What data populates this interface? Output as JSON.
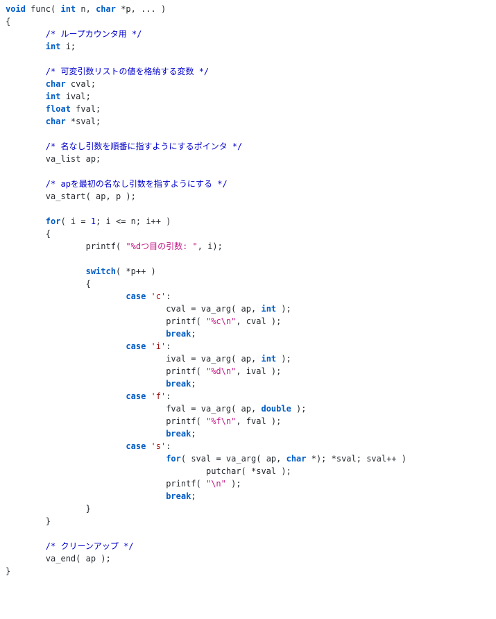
{
  "code": {
    "sig_void": "void",
    "sig_func": " func( ",
    "sig_int": "int",
    "sig_n": " n, ",
    "sig_char": "char",
    "sig_p": " *p, ... )",
    "lbrace": "{",
    "c1": "/* ループカウンタ用 */",
    "d1_kw": "int",
    "d1": " i;",
    "c2": "/* 可変引数リストの値を格納する変数 */",
    "d2_kw": "char",
    "d2": " cval;",
    "d3_kw": "int",
    "d3": " ival;",
    "d4_kw": "float",
    "d4": " fval;",
    "d5_kw": "char",
    "d5": " *sval;",
    "c3": "/* 名なし引数を順番に指すようにするポインタ */",
    "d6": "va_list ap;",
    "c4": "/* apを最初の名なし引数を指すようにする */",
    "d7": "va_start( ap, p );",
    "for_kw": "for",
    "for_open": "( i = ",
    "for_one": "1",
    "for_rest": "; i <= n; i++ )",
    "for_lbrace": "{",
    "pr_head": "printf( ",
    "pr_fmt": "\"%dつ目の引数: \"",
    "pr_tail": ", i);",
    "switch_kw": "switch",
    "switch_arg": "( *p++ )",
    "switch_lbrace": "{",
    "case_kw": "case",
    "case_c_lit": "'c'",
    "case_c_colon": ":",
    "case_c_l1a": "cval = va_arg( ap, ",
    "case_c_l1kw": "int",
    "case_c_l1b": " );",
    "case_c_l2a": "printf( ",
    "case_c_l2s": "\"%c\\n\"",
    "case_c_l2b": ", cval );",
    "break_kw": "break",
    "semi": ";",
    "case_i_lit": "'i'",
    "case_i_l1a": "ival = va_arg( ap, ",
    "case_i_l1kw": "int",
    "case_i_l1b": " );",
    "case_i_l2a": "printf( ",
    "case_i_l2s": "\"%d\\n\"",
    "case_i_l2b": ", ival );",
    "case_f_lit": "'f'",
    "case_f_l1a": "fval = va_arg( ap, ",
    "case_f_l1kw": "double",
    "case_f_l1b": " );",
    "case_f_l2a": "printf( ",
    "case_f_l2s": "\"%f\\n\"",
    "case_f_l2b": ", fval );",
    "case_s_lit": "'s'",
    "case_s_for_kw": "for",
    "case_s_for_a": "( sval = va_arg( ap, ",
    "case_s_for_kw2": "char",
    "case_s_for_b": " *); *sval; sval++ )",
    "case_s_put": "putchar( *sval );",
    "case_s_pra": "printf( ",
    "case_s_prs": "\"\\n\"",
    "case_s_prb": " );",
    "switch_rbrace": "}",
    "for_rbrace": "}",
    "c5": "/* クリーンアップ */",
    "d8": "va_end( ap );",
    "rbrace": "}"
  }
}
